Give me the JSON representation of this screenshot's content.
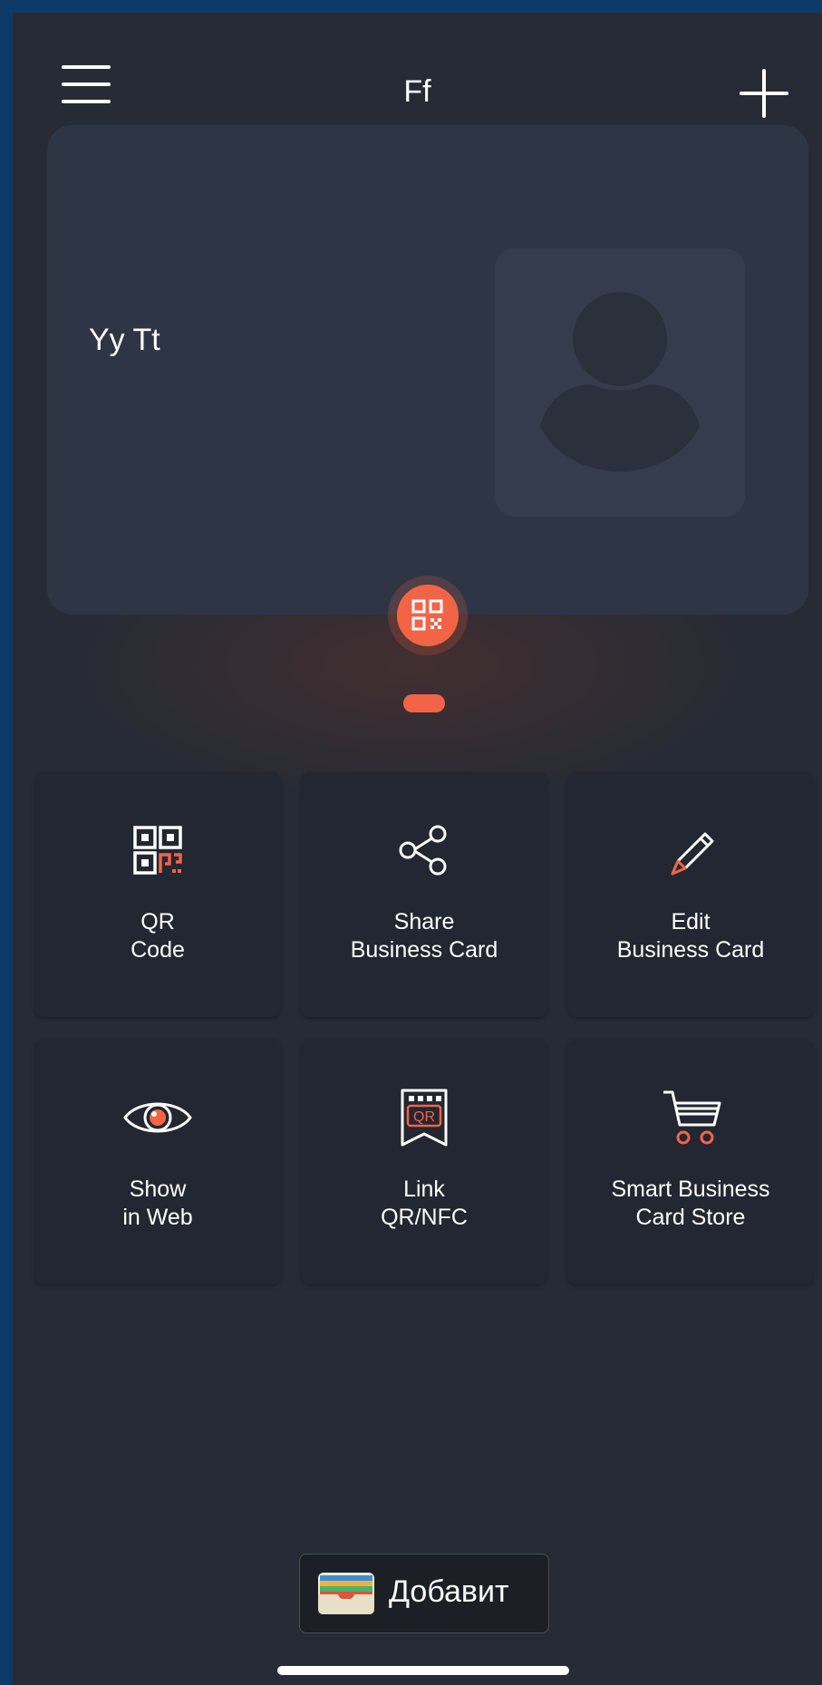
{
  "header": {
    "title": "Ff",
    "menu_icon": "hamburger-icon",
    "add_icon": "plus-icon"
  },
  "card": {
    "name": "Yy Tt",
    "avatar_icon": "person-silhouette-icon",
    "qr_icon": "qr-code-icon"
  },
  "actions": [
    {
      "label": "QR\nCode",
      "icon": "qr-code-icon"
    },
    {
      "label": "Share\nBusiness Card",
      "icon": "share-icon"
    },
    {
      "label": "Edit\nBusiness Card",
      "icon": "pencil-icon"
    },
    {
      "label": "Show\nin Web",
      "icon": "eye-icon"
    },
    {
      "label": "Link\nQR/NFC",
      "icon": "qr-tag-icon"
    },
    {
      "label": "Smart Business\nCard Store",
      "icon": "shopping-cart-icon"
    }
  ],
  "wallet": {
    "label": "Добавит",
    "icon": "wallet-icon"
  },
  "colors": {
    "accent": "#f26446",
    "background": "#262b35",
    "card": "#2e3646",
    "tile": "#222731"
  }
}
